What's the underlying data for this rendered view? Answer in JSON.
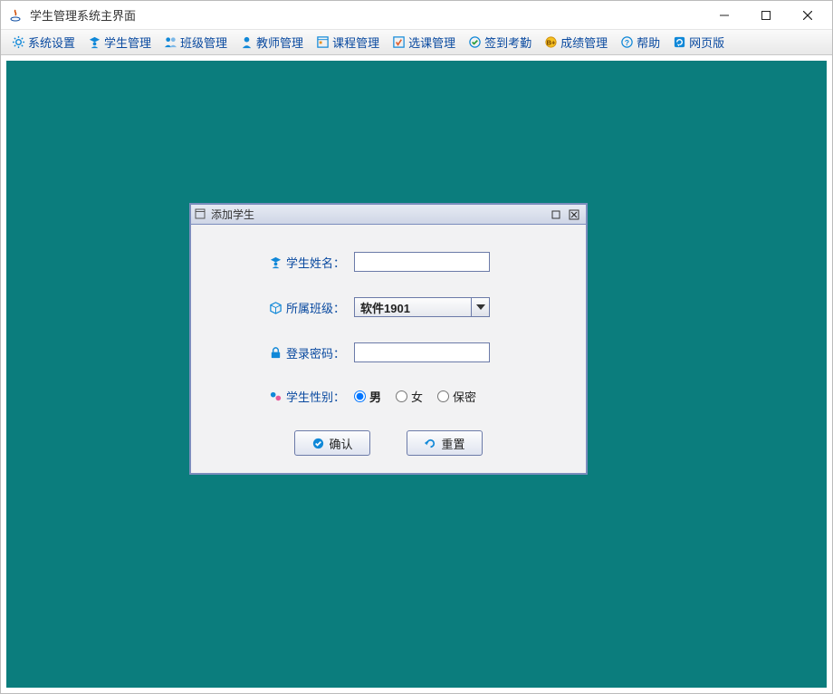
{
  "window": {
    "title": "学生管理系统主界面"
  },
  "menu": {
    "items": [
      {
        "label": "系统设置",
        "icon": "gear"
      },
      {
        "label": "学生管理",
        "icon": "student"
      },
      {
        "label": "班级管理",
        "icon": "class"
      },
      {
        "label": "教师管理",
        "icon": "teacher"
      },
      {
        "label": "课程管理",
        "icon": "course"
      },
      {
        "label": "选课管理",
        "icon": "select"
      },
      {
        "label": "签到考勤",
        "icon": "checkin"
      },
      {
        "label": "成绩管理",
        "icon": "grade"
      },
      {
        "label": "帮助",
        "icon": "help"
      },
      {
        "label": "网页版",
        "icon": "web"
      }
    ]
  },
  "dialog": {
    "title": "添加学生",
    "fields": {
      "name_label": "学生姓名：",
      "name_value": "",
      "class_label": "所属班级：",
      "class_value": "软件1901",
      "password_label": "登录密码：",
      "password_value": "",
      "gender_label": "学生性别："
    },
    "gender_options": [
      "男",
      "女",
      "保密"
    ],
    "gender_selected": "男",
    "buttons": {
      "ok": "确认",
      "reset": "重置"
    }
  }
}
